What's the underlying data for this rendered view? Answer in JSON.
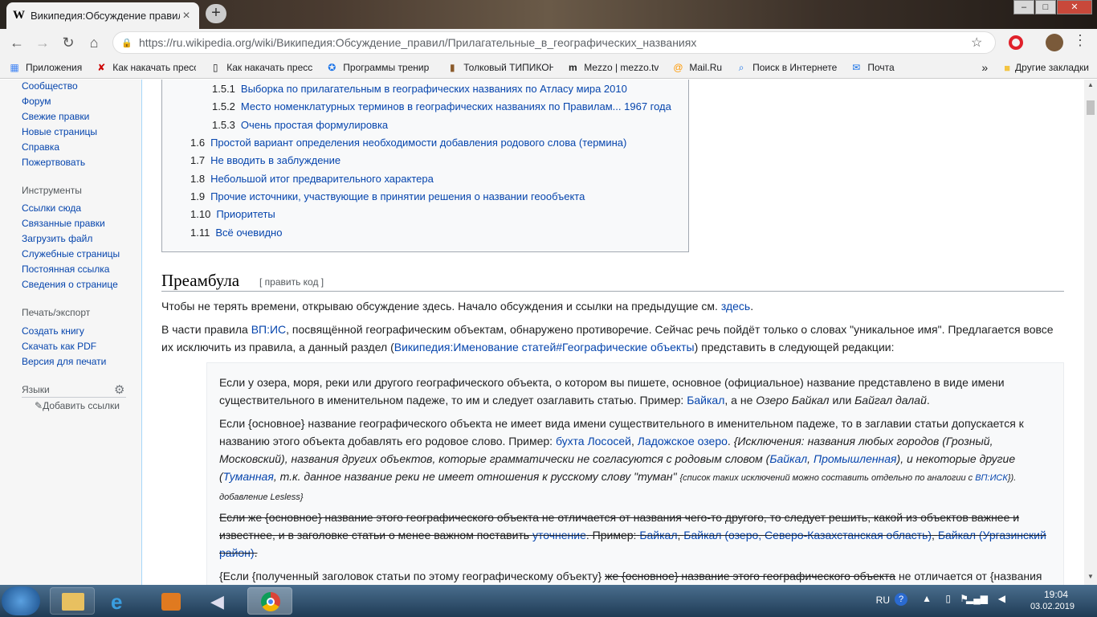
{
  "browser": {
    "tab_title": "Википедия:Обсуждение правил",
    "tab_favicon": "W",
    "url": "https://ru.wikipedia.org/wiki/Википедия:Обсуждение_правил/Прилагательные_в_географических_названиях",
    "bookmarks": [
      {
        "icon": "apps-icon",
        "label": "Приложения"
      },
      {
        "icon": "bookmark-red-icon",
        "label": "Как накачать пресс д"
      },
      {
        "icon": "page-icon",
        "label": "Как накачать пресс"
      },
      {
        "icon": "fitness-icon",
        "label": "Программы тренир"
      },
      {
        "icon": "book-icon",
        "label": "Толковый ТИПИКОН"
      },
      {
        "icon": "mezzo-icon",
        "label": "Mezzo | mezzo.tv"
      },
      {
        "icon": "mail-icon",
        "label": "Mail.Ru"
      },
      {
        "icon": "search-icon",
        "label": "Поиск в Интернете"
      },
      {
        "icon": "envelope-icon",
        "label": "Почта"
      }
    ],
    "other_bookmarks": "Другие закладки"
  },
  "sidebar": {
    "nav_items": [
      "Сообщество",
      "Форум",
      "Свежие правки",
      "Новые страницы",
      "Справка",
      "Пожертвовать"
    ],
    "tools_heading": "Инструменты",
    "tools_items": [
      "Ссылки сюда",
      "Связанные правки",
      "Загрузить файл",
      "Служебные страницы",
      "Постоянная ссылка",
      "Сведения о странице"
    ],
    "print_heading": "Печать/экспорт",
    "print_items": [
      "Создать книгу",
      "Скачать как PDF",
      "Версия для печати"
    ],
    "languages_heading": "Языки",
    "add_links": "Добавить ссылки"
  },
  "toc": [
    {
      "num": "1.5.1",
      "text": "Выборка по прилагательным в географических названиях по Атласу мира 2010"
    },
    {
      "num": "1.5.2",
      "text": "Место номенклатурных терминов в географических названиях по Правилам... 1967 года"
    },
    {
      "num": "1.5.3",
      "text": "Очень простая формулировка"
    },
    {
      "num": "1.6",
      "text": "Простой вариант определения необходимости добавления родового слова (термина)"
    },
    {
      "num": "1.7",
      "text": "Не вводить в заблуждение"
    },
    {
      "num": "1.8",
      "text": "Небольшой итог предварительного характера"
    },
    {
      "num": "1.9",
      "text": "Прочие источники, участвующие в принятии решения о названии геообъекта"
    },
    {
      "num": "1.10",
      "text": "Приоритеты"
    },
    {
      "num": "1.11",
      "text": "Всё очевидно"
    }
  ],
  "section": {
    "heading": "Преамбула",
    "edit_link": "[ править код ]",
    "p1_text": "Чтобы не терять времени, открываю обсуждение здесь. Начало обсуждения и ссылки на предыдущие см.",
    "p1_link": "здесь",
    "p2_a": "В части правила",
    "p2_link1": "ВП:ИС",
    "p2_b": ", посвящённой географическим объектам, обнаружено противоречие. Сейчас речь пойдёт только о словах \"уникальное имя\". Предлагается вовсе их исключить из правила, а данный раздел (",
    "p2_link2": "Википедия:Именование статей#Географические объекты",
    "p2_c": ") представить в следующей редакции:"
  },
  "quote": {
    "q1_a": "Если у озера, моря, реки или другого географического объекта, о котором вы пишете, основное (официальное) название представлено в виде имени существительного в именительном падеже, то им и следует озаглавить статью. Пример:",
    "q1_link": "Байкал",
    "q1_b": ", а не",
    "q1_i1": "Озеро Байкал",
    "q1_c": "или",
    "q1_i2": "Байгал далай",
    "q2_a": "Если {основное} название географического объекта не имеет вида имени существительного в именительном падеже, то в заглавии статьи допускается к названию этого объекта добавлять его родовое слово. Пример:",
    "q2_link1": "бухта Лососей",
    "q2_link2": "Ладожское озеро",
    "q2_i1": "{Исключения: названия любых городов (Грозный, Московский), названия других объектов, которые грамматически не согласуются с родовым словом (",
    "q2_link3": "Байкал",
    "q2_link4": "Промышленная",
    "q2_i2": "), и некоторые другие (",
    "q2_link5": "Туманная",
    "q2_i3": ", т.к. данное название реки не имеет отношения к русскому слову \"туман\"",
    "q2_small": "{список таких исключений можно составить отдельно по аналогии с",
    "q2_link6": "ВП:ИСК",
    "q2_small2": "}). добавление Lesless}",
    "q3_a": "Если же {основное} название этого географического объекта не отличается от названия чего-то другого, то следует решить, какой из объектов важнее и известнее, и в заголовке статьи о менее важном поставить",
    "q3_link1": "уточнение",
    "q3_b": ". Пример:",
    "q3_link2": "Байкал",
    "q3_link3": "Байкал (озеро, Северо-Казахстанская область)",
    "q3_link4": "Байкал (Ургазинский район)",
    "q4_a": "{Если {полученный заголовок статьи по этому географическому объекту}",
    "q4_strike": "же {основное} название этого географического объекта",
    "q4_b": "не отличается от {названия"
  },
  "taskbar": {
    "lang": "RU",
    "time": "19:04",
    "date": "03.02.2019"
  }
}
